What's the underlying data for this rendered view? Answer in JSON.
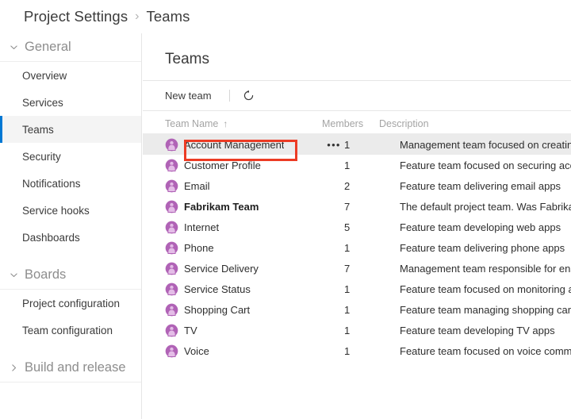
{
  "breadcrumb": {
    "root": "Project Settings",
    "separator": "›",
    "current": "Teams"
  },
  "sidebar": {
    "groups": [
      {
        "label": "General",
        "icon": "chevron-down-icon",
        "expanded": true,
        "chevron": "⌄",
        "items": [
          {
            "label": "Overview",
            "selected": false
          },
          {
            "label": "Services",
            "selected": false
          },
          {
            "label": "Teams",
            "selected": true
          },
          {
            "label": "Security",
            "selected": false
          },
          {
            "label": "Notifications",
            "selected": false
          },
          {
            "label": "Service hooks",
            "selected": false
          },
          {
            "label": "Dashboards",
            "selected": false
          }
        ]
      },
      {
        "label": "Boards",
        "icon": "chevron-down-icon",
        "expanded": true,
        "chevron": "⌄",
        "items": [
          {
            "label": "Project configuration",
            "selected": false
          },
          {
            "label": "Team configuration",
            "selected": false
          }
        ]
      },
      {
        "label": "Build and release",
        "icon": "chevron-right-icon",
        "expanded": false,
        "chevron": "›",
        "items": []
      }
    ]
  },
  "main": {
    "title": "Teams",
    "toolbar": {
      "new_team_label": "New team",
      "refresh_icon": "refresh-icon"
    },
    "table": {
      "columns": [
        {
          "key": "name",
          "label": "Team Name",
          "sorted": true,
          "sort_arrow": "↑"
        },
        {
          "key": "members",
          "label": "Members",
          "sorted": false,
          "sort_arrow": ""
        },
        {
          "key": "description",
          "label": "Description",
          "sorted": false,
          "sort_arrow": ""
        }
      ],
      "ellipsis_label": "•••",
      "rows": [
        {
          "name": "Account Management",
          "members": "1",
          "description": "Management team focused on creating an",
          "active": true,
          "bold": false,
          "avatar": "team-avatar-icon"
        },
        {
          "name": "Customer Profile",
          "members": "1",
          "description": "Feature team focused on securing account",
          "active": false,
          "bold": false,
          "avatar": "team-avatar-icon"
        },
        {
          "name": "Email",
          "members": "2",
          "description": "Feature team delivering email apps",
          "active": false,
          "bold": false,
          "avatar": "team-avatar-icon"
        },
        {
          "name": "Fabrikam Team",
          "members": "7",
          "description": "The default project team. Was Fabrikam Fi",
          "active": false,
          "bold": true,
          "avatar": "team-avatar-icon"
        },
        {
          "name": "Internet",
          "members": "5",
          "description": "Feature team developing web apps",
          "active": false,
          "bold": false,
          "avatar": "team-avatar-icon"
        },
        {
          "name": "Phone",
          "members": "1",
          "description": "Feature team delivering phone apps",
          "active": false,
          "bold": false,
          "avatar": "team-avatar-icon"
        },
        {
          "name": "Service Delivery",
          "members": "7",
          "description": "Management team responsible for ensure",
          "active": false,
          "bold": false,
          "avatar": "team-avatar-icon"
        },
        {
          "name": "Service Status",
          "members": "1",
          "description": "Feature team focused on monitoring and ",
          "active": false,
          "bold": false,
          "avatar": "team-avatar-icon"
        },
        {
          "name": "Shopping Cart",
          "members": "1",
          "description": "Feature team managing shopping cart app",
          "active": false,
          "bold": false,
          "avatar": "team-avatar-icon"
        },
        {
          "name": "TV",
          "members": "1",
          "description": "Feature team developing TV apps",
          "active": false,
          "bold": false,
          "avatar": "team-avatar-icon"
        },
        {
          "name": "Voice",
          "members": "1",
          "description": "Feature team focused on voice communic",
          "active": false,
          "bold": false,
          "avatar": "team-avatar-icon"
        }
      ]
    }
  },
  "annotation": {
    "highlight_color": "#ec3b24",
    "target": "Account Management"
  },
  "colors": {
    "accent": "#0078d4",
    "selection_bg": "#f4f4f4",
    "row_active_bg": "#ebebeb",
    "avatar_purple": "#b063b6",
    "avatar_fill": "#e4bde7",
    "divider": "#e6e6e6",
    "text": "#3b3b3b",
    "muted": "#a4a4a4"
  }
}
